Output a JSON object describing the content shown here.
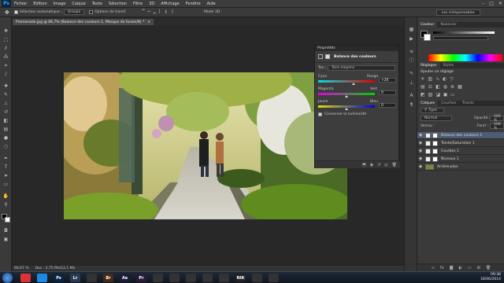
{
  "menubar": {
    "logo": "Ps",
    "items": [
      "Fichier",
      "Edition",
      "Image",
      "Calque",
      "Texte",
      "Sélection",
      "Filtre",
      "3D",
      "Affichage",
      "Fenêtre",
      "Aide"
    ],
    "minimize": "–",
    "maximize": "□",
    "close": "✕"
  },
  "options": {
    "auto_select_label": "Sélection automatique :",
    "auto_select_value": "Groupe",
    "transform_label": "Options de transf.",
    "mode3d_label": "Mode 3D :",
    "workspace": "Les indispensables"
  },
  "document_tab": {
    "title": "Promenade.jpg @ 66,7% (Balance des couleurs 1, Masque de fusion/8) *",
    "close": "×"
  },
  "status": {
    "zoom": "66,67 %",
    "doc": "Doc : 2,75 Mo/12,1 Mo"
  },
  "properties": {
    "panel_title": "Propriétés",
    "header": "Balance des couleurs",
    "tone_label": "Ton :",
    "tone_value": "Tons moyens",
    "sliders": [
      {
        "left": "Cyan",
        "right": "Rouge",
        "value": "+26",
        "position": 0.62
      },
      {
        "left": "Magenta",
        "right": "Vert",
        "value": "0",
        "position": 0.5
      },
      {
        "left": "Jaune",
        "right": "Bleu",
        "value": "0",
        "position": 0.5
      }
    ],
    "preserve_luminosity": "Conserver la luminosité"
  },
  "right_panels": {
    "color_tabs": [
      "Couleur",
      "Nuancier"
    ],
    "adjust_tabs": [
      "Réglages",
      "Styles"
    ],
    "adjust_title": "Ajouter un réglage",
    "layer_tabs": [
      "Calques",
      "Couches",
      "Tracés"
    ],
    "kind_label": "Type",
    "blend_mode": "Normal",
    "opacity_label": "Opacité :",
    "opacity_value": "100 %",
    "lock_label": "Verrou :",
    "fill_label": "Fond :",
    "fill_value": "100 %",
    "layers": [
      {
        "name": "Balance des couleurs 1",
        "selected": true
      },
      {
        "name": "Teinte/Saturation 1",
        "selected": false
      },
      {
        "name": "Courbes 1",
        "selected": false
      },
      {
        "name": "Niveaux 1",
        "selected": false
      },
      {
        "name": "Arrière-plan",
        "selected": false
      }
    ]
  },
  "taskbar": {
    "time": "09:38",
    "date": "18/06/2014",
    "apps": [
      {
        "label": "",
        "color": "#d33"
      },
      {
        "label": "",
        "color": "#1e88e5"
      },
      {
        "label": "Ps",
        "color": "#0a2540"
      },
      {
        "label": "Lr",
        "color": "#2a3a52"
      },
      {
        "label": "",
        "color": "#333"
      },
      {
        "label": "Br",
        "color": "#4a2a10"
      },
      {
        "label": "Ae",
        "color": "#1c1c3a"
      },
      {
        "label": "Pr",
        "color": "#2a1b3a"
      },
      {
        "label": "",
        "color": "#333"
      },
      {
        "label": "",
        "color": "#333"
      },
      {
        "label": "",
        "color": "#333"
      },
      {
        "label": "",
        "color": "#333"
      },
      {
        "label": "",
        "color": "#333"
      },
      {
        "label": "NIK",
        "color": "#222"
      },
      {
        "label": "",
        "color": "#333"
      },
      {
        "label": "",
        "color": "#333"
      }
    ]
  }
}
